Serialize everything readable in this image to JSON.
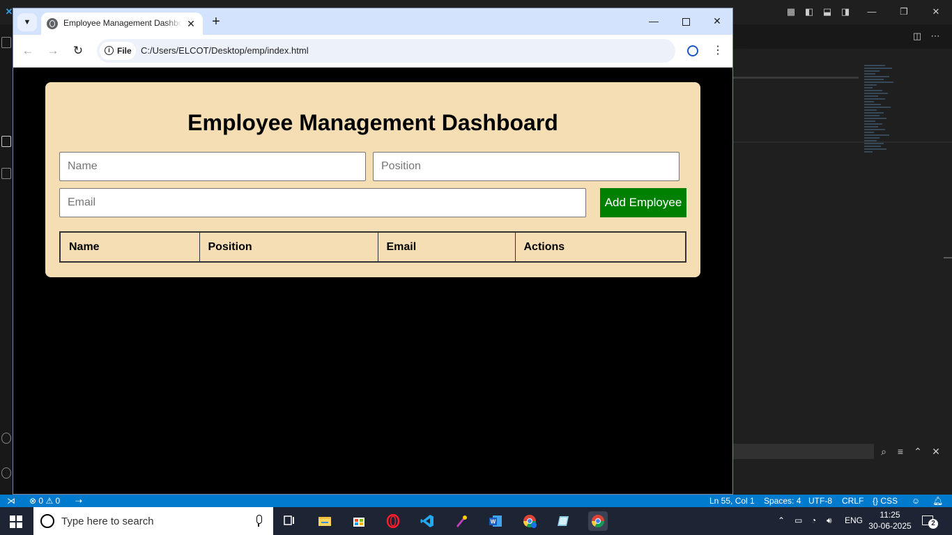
{
  "browser": {
    "tab_title": "Employee Management Dashboard",
    "close_tab": "✕",
    "new_tab": "+",
    "chip_label": "File",
    "url": "C:/Users/ELCOT/Desktop/emp/index.html"
  },
  "page": {
    "heading": "Employee Management Dashboard",
    "name_placeholder": "Name",
    "position_placeholder": "Position",
    "email_placeholder": "Email",
    "add_button": "Add Employee",
    "table_headers": [
      "Name",
      "Position",
      "Email",
      "Actions"
    ]
  },
  "vscode_status": {
    "errors": "0",
    "warnings": "0",
    "position": "Ln 55, Col 1",
    "spaces": "Spaces: 4",
    "encoding": "UTF-8",
    "eol": "CRLF",
    "language": "CSS"
  },
  "taskbar": {
    "search_placeholder": "Type here to search",
    "language": "ENG",
    "time": "11:25",
    "date": "30-06-2025",
    "notification_count": "2"
  },
  "colors": {
    "card_bg": "#f5deb3",
    "add_button_bg": "#008000",
    "status_bar_bg": "#007acc",
    "taskbar_bg": "#1d2433"
  }
}
